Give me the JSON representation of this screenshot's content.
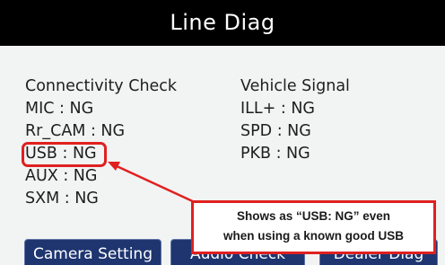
{
  "header": {
    "title": "Line Diag"
  },
  "connectivity": {
    "heading": "Connectivity Check",
    "items": [
      "MIC : NG",
      "Rr_CAM : NG",
      "USB : NG",
      "AUX : NG",
      "SXM : NG"
    ]
  },
  "vehicle": {
    "heading": "Vehicle Signal",
    "items": [
      "ILL+ : NG",
      "SPD : NG",
      "PKB : NG"
    ]
  },
  "buttons": {
    "camera_setting": "Camera Setting",
    "audio_check": "Audio Check",
    "dealer_diag": "Dealer Diag"
  },
  "annotation": {
    "line1": "Shows as “USB: NG” even",
    "line2": "when using a known good USB",
    "color": "#e02020"
  },
  "colors": {
    "title_bg": "#000000",
    "content_bg": "#f2f3f3",
    "button_bg": "#1e3570"
  }
}
